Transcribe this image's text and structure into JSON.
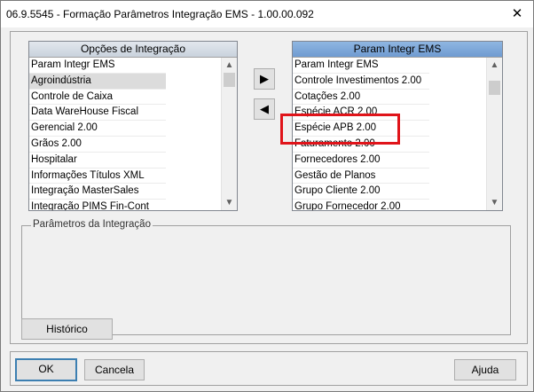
{
  "window": {
    "title": "06.9.5545 - Formação Parâmetros Integração EMS - 1.00.00.092",
    "close_glyph": "✕"
  },
  "left_list": {
    "header": "Opções de Integração",
    "items": [
      "Param Integr EMS",
      "Agroindústria",
      "Controle de Caixa",
      "Data WareHouse Fiscal",
      "Gerencial 2.00",
      "Grãos 2.00",
      "Hospitalar",
      "Informações Títulos XML",
      "Integração MasterSales",
      "Integração PIMS Fin-Cont"
    ],
    "selected_index": 1
  },
  "right_list": {
    "header": "Param Integr EMS",
    "items": [
      "Param Integr EMS",
      "Controle Investimentos 2.00",
      "Cotações 2.00",
      "Espécie ACR 2.00",
      "Espécie APB 2.00",
      "Faturamento 2.00",
      "Fornecedores 2.00",
      "Gestão de Planos",
      "Grupo Cliente 2.00",
      "Grupo Fornecedor 2.00"
    ],
    "focused_index": 4
  },
  "transfer": {
    "add_glyph": "▶",
    "remove_glyph": "◀"
  },
  "scroll": {
    "up_glyph": "▲",
    "down_glyph": "▼"
  },
  "group": {
    "label": "Parâmetros da Integração"
  },
  "buttons": {
    "historico": "Histórico",
    "ok": "OK",
    "cancela": "Cancela",
    "ajuda": "Ajuda"
  },
  "colors": {
    "highlight": "#e0141a",
    "active_header": "#7aa6d9"
  }
}
